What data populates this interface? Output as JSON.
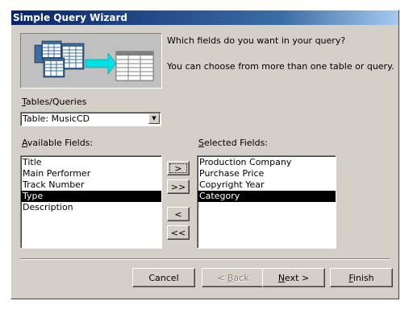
{
  "window": {
    "title": "Simple Query Wizard"
  },
  "intro": {
    "question": "Which fields do you want in your query?",
    "hint": "You can choose from more than one table or query."
  },
  "tables": {
    "label_key": "T",
    "label_rest": "ables/Queries",
    "selected": "Table: MusicCD"
  },
  "available": {
    "label_key": "A",
    "label_rest": "vailable Fields:",
    "items": [
      "Title",
      "Main Performer",
      "Track Number",
      "Type",
      "Description"
    ]
  },
  "selected_fields": {
    "label_key": "S",
    "label_rest": "elected Fields:",
    "items": [
      "Production Company",
      "Purchase Price",
      "Copyright Year",
      "Category"
    ]
  },
  "move_buttons": {
    "add_one": ">",
    "add_all": ">>",
    "remove_one": "<",
    "remove_all": "<<"
  },
  "footer": {
    "cancel": "Cancel",
    "back_prefix": "< ",
    "back_key": "B",
    "back_rest": "ack",
    "next_key": "N",
    "next_rest": "ext >",
    "finish_key": "F",
    "finish_rest": "inish"
  },
  "colors": {
    "titlebar": "#0a246a",
    "face": "#d4d0c8",
    "selection": "#000000"
  },
  "icons": {
    "illustration": "tables-to-query-illustration",
    "dropdown": "chevron-down-icon"
  }
}
